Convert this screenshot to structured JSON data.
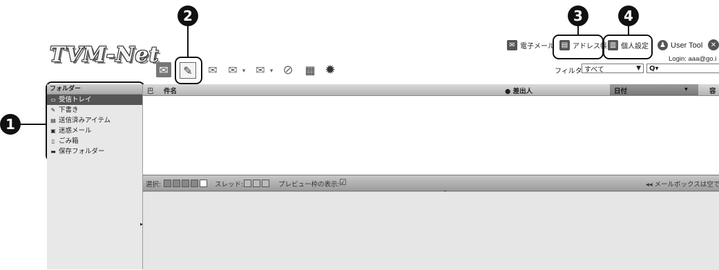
{
  "app": {
    "logo": "TVM-Net"
  },
  "callouts": [
    "1",
    "2",
    "3",
    "4"
  ],
  "toplinks": {
    "mail": "電子メール",
    "address_book": "アドレス帳",
    "settings": "個人設定",
    "user_tool": "User Tool"
  },
  "login": "Login: aaa@go.i",
  "filter": {
    "label": "フィルター:",
    "value": "すべて",
    "search_icon": "Q▾"
  },
  "folders": {
    "header": "フォルダー",
    "items": [
      {
        "label": "受信トレイ",
        "icon": "inbox-icon"
      },
      {
        "label": "下書き",
        "icon": "pencil-icon"
      },
      {
        "label": "送信済みアイテム",
        "icon": "sent-icon"
      },
      {
        "label": "迷惑メール",
        "icon": "junk-icon"
      },
      {
        "label": "ごみ箱",
        "icon": "trash-icon"
      },
      {
        "label": "保存フォルダー",
        "icon": "folder-icon"
      }
    ]
  },
  "list_header": {
    "flag": "巴",
    "subject": "件名",
    "sender": "● 差出人",
    "date": "日付",
    "sort": "▾",
    "extra": "容"
  },
  "status": {
    "select_label": "選択:",
    "thread_label": "スレッド:",
    "preview_label": "プレビュー枠の表示:",
    "checkbox": "☑",
    "message": "◂◂ メールボックスは空で"
  },
  "colors": {
    "selected_folder": "#555555",
    "callout": "#111111"
  }
}
